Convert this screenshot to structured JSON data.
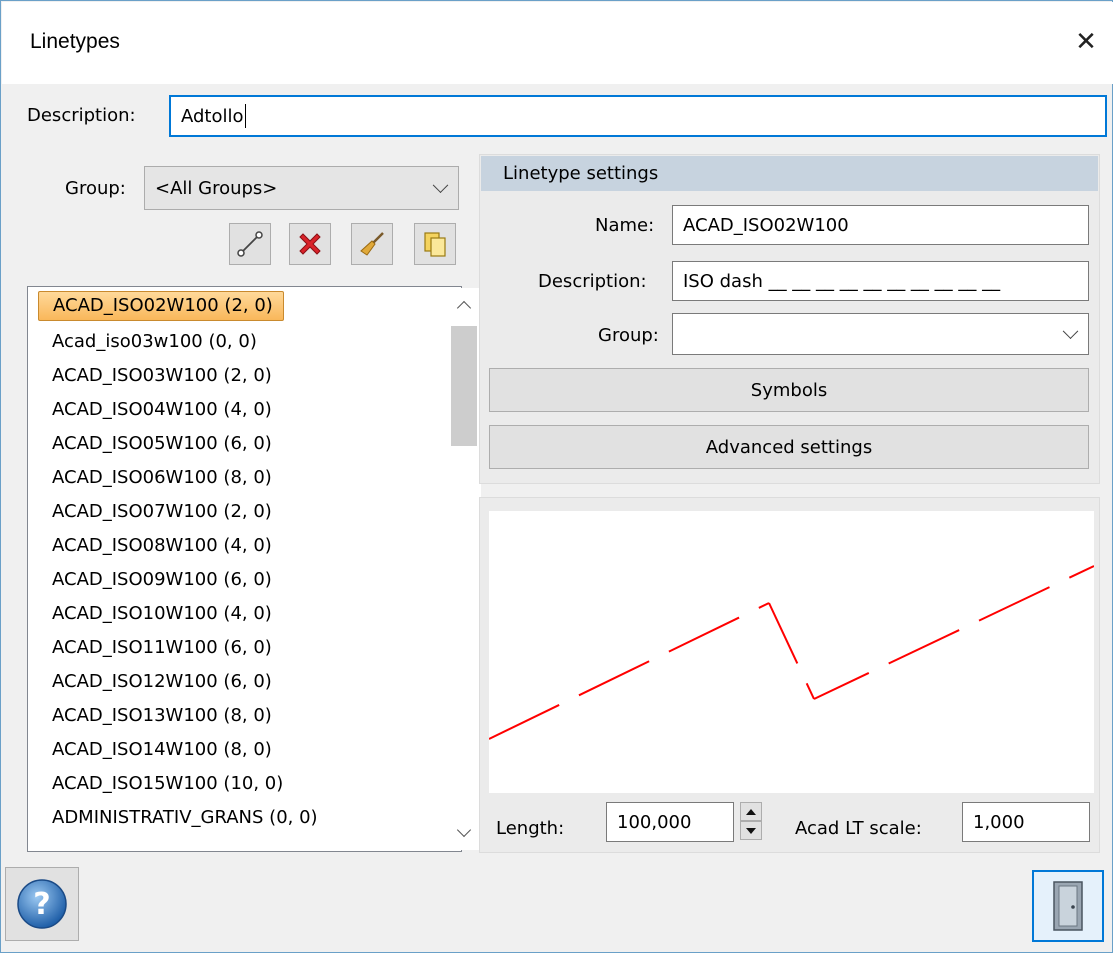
{
  "window": {
    "title": "Linetypes",
    "close_glyph": "✕"
  },
  "description_field": {
    "label": "Description:",
    "value": "Adtollo"
  },
  "group_filter": {
    "label": "Group:",
    "selected": "<All Groups>"
  },
  "toolbar": {
    "icons": [
      "new-linetype-icon",
      "delete-icon",
      "clean-icon",
      "copy-icon"
    ]
  },
  "linetype_list": {
    "items": [
      "ACAD_ISO02W100 (2, 0)",
      "Acad_iso03w100 (0, 0)",
      "ACAD_ISO03W100 (2, 0)",
      "ACAD_ISO04W100 (4, 0)",
      "ACAD_ISO05W100 (6, 0)",
      "ACAD_ISO06W100 (8, 0)",
      "ACAD_ISO07W100 (2, 0)",
      "ACAD_ISO08W100 (4, 0)",
      "ACAD_ISO09W100 (6, 0)",
      "ACAD_ISO10W100 (4, 0)",
      "ACAD_ISO11W100 (6, 0)",
      "ACAD_ISO12W100 (6, 0)",
      "ACAD_ISO13W100 (8, 0)",
      "ACAD_ISO14W100 (8, 0)",
      "ACAD_ISO15W100 (10, 0)",
      "ADMINISTRATIV_GRANS (0, 0)"
    ],
    "selected_index": 0
  },
  "settings": {
    "header": "Linetype settings",
    "name_label": "Name:",
    "name_value": "ACAD_ISO02W100",
    "description_label": "Description:",
    "description_value": "ISO dash __ __ __ __ __ __ __ __ __ __",
    "group_label": "Group:",
    "group_value": "",
    "symbols_button": "Symbols",
    "advanced_button": "Advanced settings"
  },
  "preview": {
    "line_color": "#ff0000",
    "length_label": "Length:",
    "length_value": "100,000",
    "scale_label": "Acad LT scale:",
    "scale_value": "1,000"
  },
  "footer": {
    "help_icon": "help-icon",
    "exit_icon": "exit-door-icon"
  },
  "colors": {
    "accent": "#0078d7",
    "selection": "#f9b75a",
    "header_bg": "#c7d3df"
  }
}
